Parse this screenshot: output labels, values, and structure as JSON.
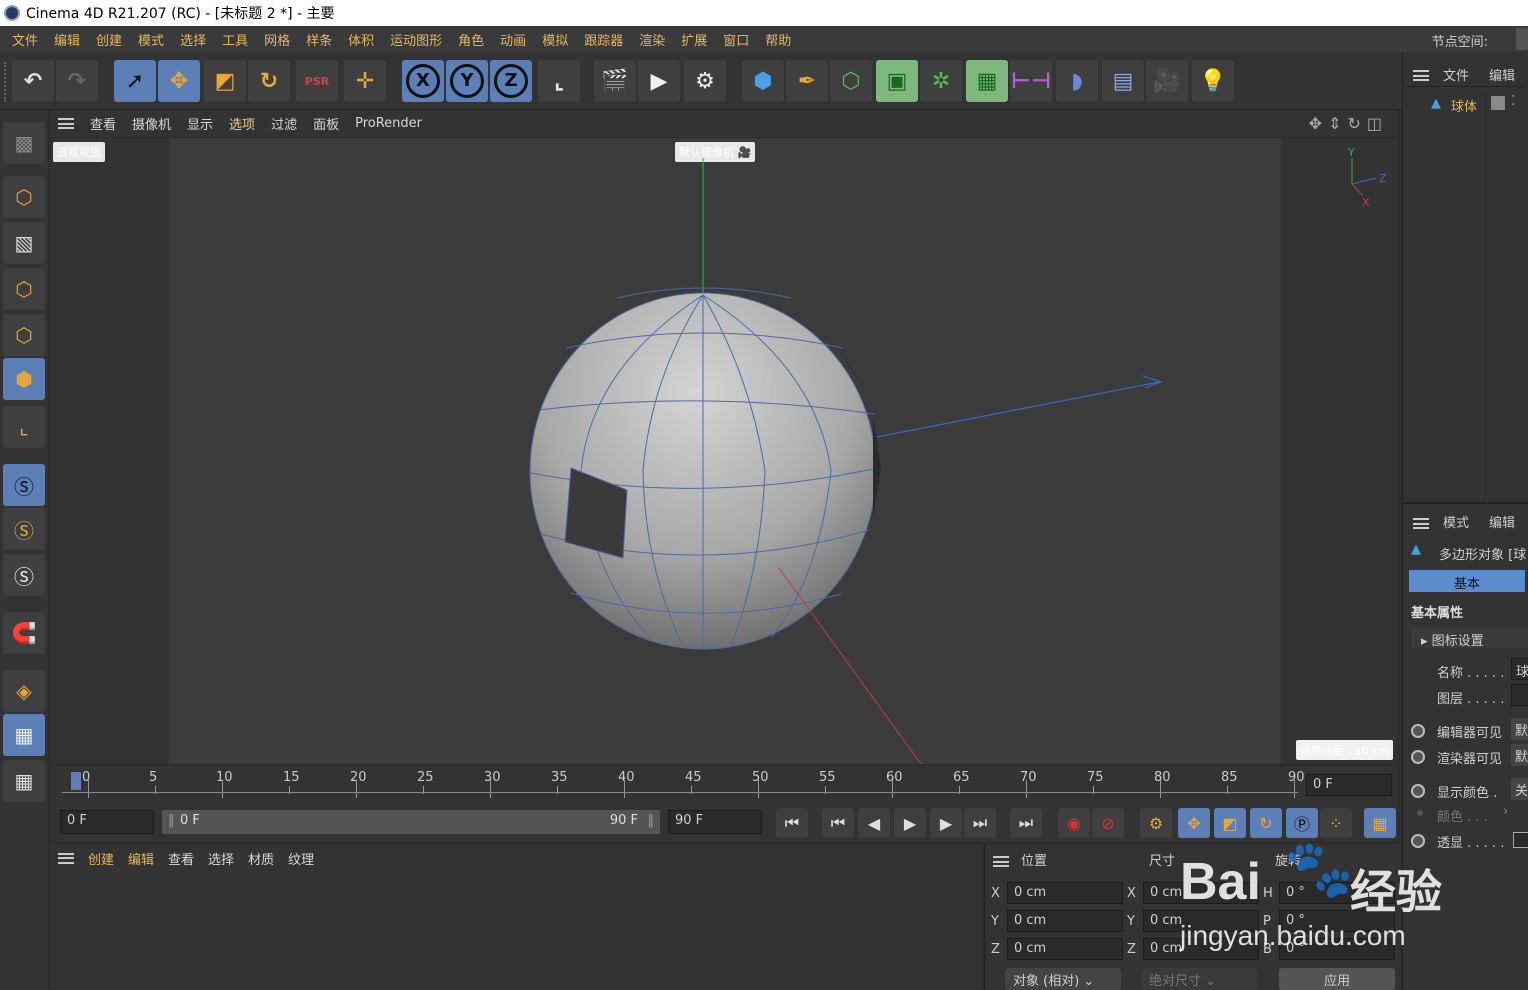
{
  "titlebar": {
    "text": "Cinema 4D R21.207 (RC) - [未标题 2 *] - 主要"
  },
  "menu": [
    "文件",
    "编辑",
    "创建",
    "模式",
    "选择",
    "工具",
    "网格",
    "样条",
    "体积",
    "运动图形",
    "角色",
    "动画",
    "模拟",
    "跟踪器",
    "渲染",
    "扩展",
    "窗口",
    "帮助"
  ],
  "node_space_label": "节点空间:",
  "toolbar": {
    "icons": [
      "undo-icon",
      "redo-icon",
      "select-icon",
      "move-icon",
      "scale-icon",
      "rotate-icon",
      "psr-icon",
      "add-icon",
      "x-axis-icon",
      "y-axis-icon",
      "z-axis-icon",
      "coordinate-system-icon",
      "render-region-icon",
      "render-view-icon",
      "render-settings-icon",
      "cube-icon",
      "pen-icon",
      "subdivision-icon",
      "extrude-icon",
      "cloner-icon",
      "array-icon",
      "deformer-icon",
      "field-icon",
      "floor-icon",
      "camera-icon",
      "light-icon"
    ]
  },
  "viewport_menu": [
    "查看",
    "摄像机",
    "显示",
    "选项",
    "过滤",
    "面板",
    "ProRender"
  ],
  "viewport": {
    "view_label": "透视视图",
    "camera_label": "默认摄像机",
    "grid_label": "网格间距 : 10 cm",
    "axis_y": "Y",
    "axis_z": "Z",
    "axis_x": "X"
  },
  "timeline": {
    "ticks": [
      "0",
      "5",
      "10",
      "15",
      "20",
      "25",
      "30",
      "35",
      "40",
      "45",
      "50",
      "55",
      "60",
      "65",
      "70",
      "75",
      "80",
      "85",
      "90"
    ],
    "current_frame": "0 F"
  },
  "playbar": {
    "start": "0 F",
    "range_start": "0 F",
    "range_end": "90 F",
    "end": "90 F"
  },
  "material_menu": [
    "创建",
    "编辑",
    "查看",
    "选择",
    "材质",
    "纹理"
  ],
  "coords": {
    "headers": [
      "位置",
      "尺寸",
      "旋转"
    ],
    "rows": [
      {
        "axis": "X",
        "pos": "0 cm",
        "size": "0 cm",
        "rot_axis": "H",
        "rot": "0 °"
      },
      {
        "axis": "Y",
        "pos": "0 cm",
        "size": "0 cm",
        "rot_axis": "P",
        "rot": "0 °"
      },
      {
        "axis": "Z",
        "pos": "0 cm",
        "size": "0 cm",
        "rot_axis": "B",
        "rot": "0 °"
      }
    ],
    "mode": "对象 (相对)",
    "size_mode": "绝对尺寸",
    "apply": "应用"
  },
  "objects_panel": {
    "menu": [
      "文件",
      "编辑"
    ],
    "object_name": "球体"
  },
  "attributes_panel": {
    "menu": [
      "模式",
      "编辑"
    ],
    "object_type": "多边形对象 [球",
    "tab": "基本",
    "section": "基本属性",
    "subsection": "图标设置",
    "fields": [
      {
        "label": "名称 . . . . .",
        "value": "球"
      },
      {
        "label": "图层 . . . . .",
        "value": ""
      },
      {
        "label": "编辑器可见",
        "value": "默"
      },
      {
        "label": "渲染器可见",
        "value": "默"
      },
      {
        "label": "显示颜色 .",
        "value": "关"
      },
      {
        "label": "颜色 . . .",
        "value": ""
      },
      {
        "label": "透显 . . . . .",
        "value": ""
      }
    ]
  },
  "watermark": {
    "brand": "Bai",
    "brand2": "经验",
    "url": "jingyan.baidu.com"
  }
}
